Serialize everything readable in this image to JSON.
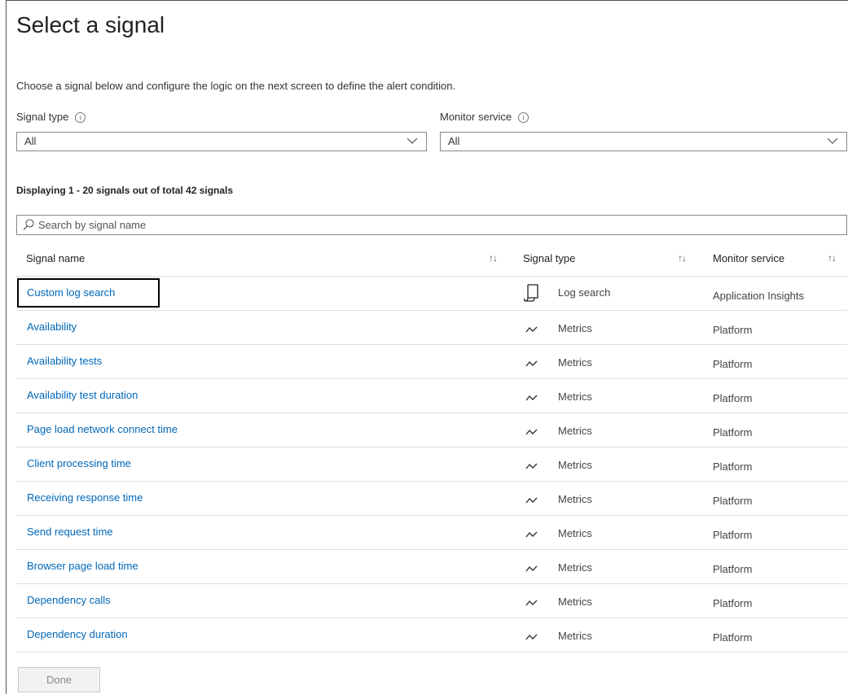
{
  "page": {
    "title": "Select a signal",
    "description": "Choose a signal below and configure the logic on the next screen to define the alert condition."
  },
  "filters": {
    "signal_type_label": "Signal type",
    "signal_type_value": "All",
    "monitor_service_label": "Monitor service",
    "monitor_service_value": "All"
  },
  "count_text": "Displaying 1 - 20 signals out of total 42 signals",
  "search": {
    "placeholder": "Search by signal name"
  },
  "table": {
    "columns": [
      "Signal name",
      "Signal type",
      "Monitor service"
    ],
    "rows": [
      {
        "name": "Custom log search",
        "icon": "log-search-icon",
        "type": "Log search",
        "service": "Application Insights"
      },
      {
        "name": "Availability",
        "icon": "metrics-icon",
        "type": "Metrics",
        "service": "Platform"
      },
      {
        "name": "Availability tests",
        "icon": "metrics-icon",
        "type": "Metrics",
        "service": "Platform"
      },
      {
        "name": "Availability test duration",
        "icon": "metrics-icon",
        "type": "Metrics",
        "service": "Platform"
      },
      {
        "name": "Page load network connect time",
        "icon": "metrics-icon",
        "type": "Metrics",
        "service": "Platform"
      },
      {
        "name": "Client processing time",
        "icon": "metrics-icon",
        "type": "Metrics",
        "service": "Platform"
      },
      {
        "name": "Receiving response time",
        "icon": "metrics-icon",
        "type": "Metrics",
        "service": "Platform"
      },
      {
        "name": "Send request time",
        "icon": "metrics-icon",
        "type": "Metrics",
        "service": "Platform"
      },
      {
        "name": "Browser page load time",
        "icon": "metrics-icon",
        "type": "Metrics",
        "service": "Platform"
      },
      {
        "name": "Dependency calls",
        "icon": "metrics-icon",
        "type": "Metrics",
        "service": "Platform"
      },
      {
        "name": "Dependency duration",
        "icon": "metrics-icon",
        "type": "Metrics",
        "service": "Platform"
      }
    ]
  },
  "done_label": "Done",
  "colors": {
    "link": "#0067b8",
    "border": "#8a8886",
    "divider": "#e1dfdd"
  }
}
